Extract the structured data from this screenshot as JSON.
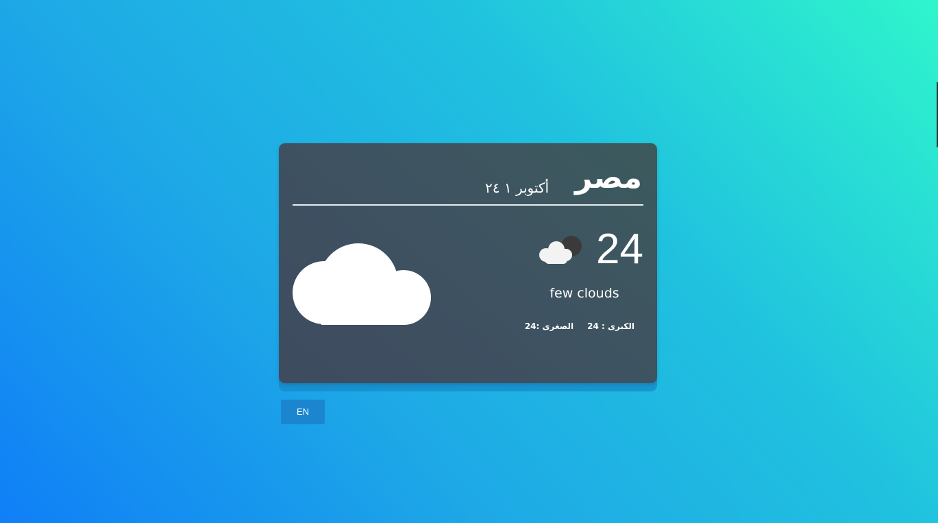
{
  "card": {
    "city": "مصر",
    "date": "أكتوبر ١ ٢٤",
    "main_icon": "cloud-icon",
    "condition_icon": "few-clouds-night-icon",
    "temperature": "24",
    "description": "few clouds",
    "min_label": "الصغرى :24",
    "max_label": "الكبرى : 24"
  },
  "language_button": {
    "label": "EN"
  },
  "colors": {
    "background_start": "#0f7ff7",
    "background_end": "#2ff5cc",
    "card": "#3e5361",
    "button": "#1b86cf",
    "text": "#ffffff"
  }
}
